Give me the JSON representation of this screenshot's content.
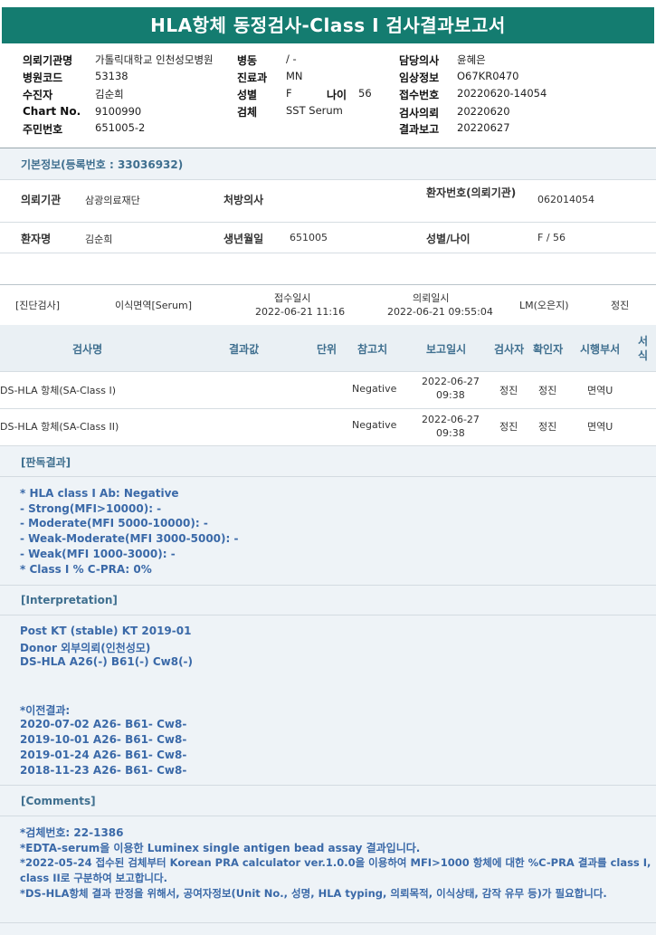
{
  "title": "HLA항체 동정검사-Class I 검사결과보고서",
  "header": {
    "hospital_label": "의뢰기관명",
    "hospital_value": "가톨릭대학교 인천성모병원",
    "ward_label": "병동",
    "ward_value": "/ -",
    "doctor_label": "담당의사",
    "doctor_value": "윤혜은",
    "hospcode_label": "병원코드",
    "hospcode_value": "53138",
    "dept_label": "진료과",
    "dept_value": "MN",
    "clinical_label": "임상정보",
    "clinical_value": "O67KR0470",
    "patient_label": "수진자",
    "patient_value": "김순희",
    "sex_label": "성별",
    "sex_value": "F",
    "age_label": "나이",
    "age_value": "56",
    "receipt_label": "접수번호",
    "receipt_value": "20220620-14054",
    "chart_label": "Chart No.",
    "chart_value": "9100990",
    "specimen_label": "검체",
    "specimen_value": "SST Serum",
    "request_label": "검사의뢰",
    "request_value": "20220620",
    "rrn_label": "주민번호",
    "rrn_value": "651005-2",
    "report_label": "결과보고",
    "report_value": "20220627"
  },
  "basic": {
    "title": "기본정보(등록번호 : 33036932)",
    "org_label": "의뢰기관",
    "org_value": "삼광의료재단",
    "prescriber_label": "처방의사",
    "prescriber_value": "",
    "ptno_label": "환자번호(의뢰기관)",
    "ptno_value": "062014054",
    "name_label": "환자명",
    "name_value": "김순희",
    "dob_label": "생년월일",
    "dob_value": "651005",
    "sexage_label": "성별/나이",
    "sexage_value": "F / 56"
  },
  "exam": {
    "category": "[진단검사]",
    "dept": "이식면역[Serum]",
    "received_label": "접수일시",
    "received_value": "2022-06-21 11:16",
    "requested_label": "의뢰일시",
    "requested_value": "2022-06-21 09:55:04",
    "lm": "LM(오은지)",
    "person": "정진"
  },
  "table": {
    "headers": [
      "검사명",
      "결과값",
      "단위",
      "참고치",
      "보고일시",
      "검사자",
      "확인자",
      "시행부서",
      "서식"
    ],
    "rows": [
      {
        "name": "DS-HLA 항체(SA-Class I)",
        "result": "",
        "unit": "",
        "ref": "Negative",
        "date": "2022-06-27",
        "time": "09:38",
        "tester": "정진",
        "checker": "정진",
        "dept": "면역U"
      },
      {
        "name": "DS-HLA 항체(SA-Class II)",
        "result": "",
        "unit": "",
        "ref": "Negative",
        "date": "2022-06-27",
        "time": "09:38",
        "tester": "정진",
        "checker": "정진",
        "dept": "면역U"
      }
    ]
  },
  "judgement": {
    "title": "[판독결과]",
    "lines": [
      "* HLA class I Ab: Negative",
      "- Strong(MFI>10000): -",
      "- Moderate(MFI 5000-10000): -",
      "- Weak-Moderate(MFI 3000-5000): -",
      "- Weak(MFI 1000-3000): -",
      "* Class I % C-PRA: 0%"
    ]
  },
  "interpretation": {
    "title": "[Interpretation]",
    "lines": [
      "Post KT (stable) KT 2019-01",
      "Donor 외부의뢰(인천성모)",
      "DS-HLA A26(-) B61(-) Cw8(-)"
    ],
    "prev_title": "*이전결과:",
    "prev_lines": [
      "2020-07-02 A26- B61- Cw8-",
      "2019-10-01 A26- B61- Cw8-",
      "2019-01-24 A26- B61- Cw8-",
      "2018-11-23 A26- B61- Cw8-"
    ]
  },
  "comments": {
    "title": "[Comments]",
    "lines": [
      "*검체번호: 22-1386",
      "*EDTA-serum을 이용한 Luminex single antigen bead assay 결과입니다.",
      "*2022-05-24 접수된 검체부터 Korean PRA calculator ver.1.0.0을 이용하여 MFI>1000 항체에 대한 %C-PRA 결과를 class I, class II로 구분하여 보고합니다.",
      "*DS-HLA항체 결과 판정을 위해서, 공여자정보(Unit No., 성명, HLA typing, 의뢰목적, 이식상태, 감작 유무 등)가 필요합니다."
    ]
  }
}
